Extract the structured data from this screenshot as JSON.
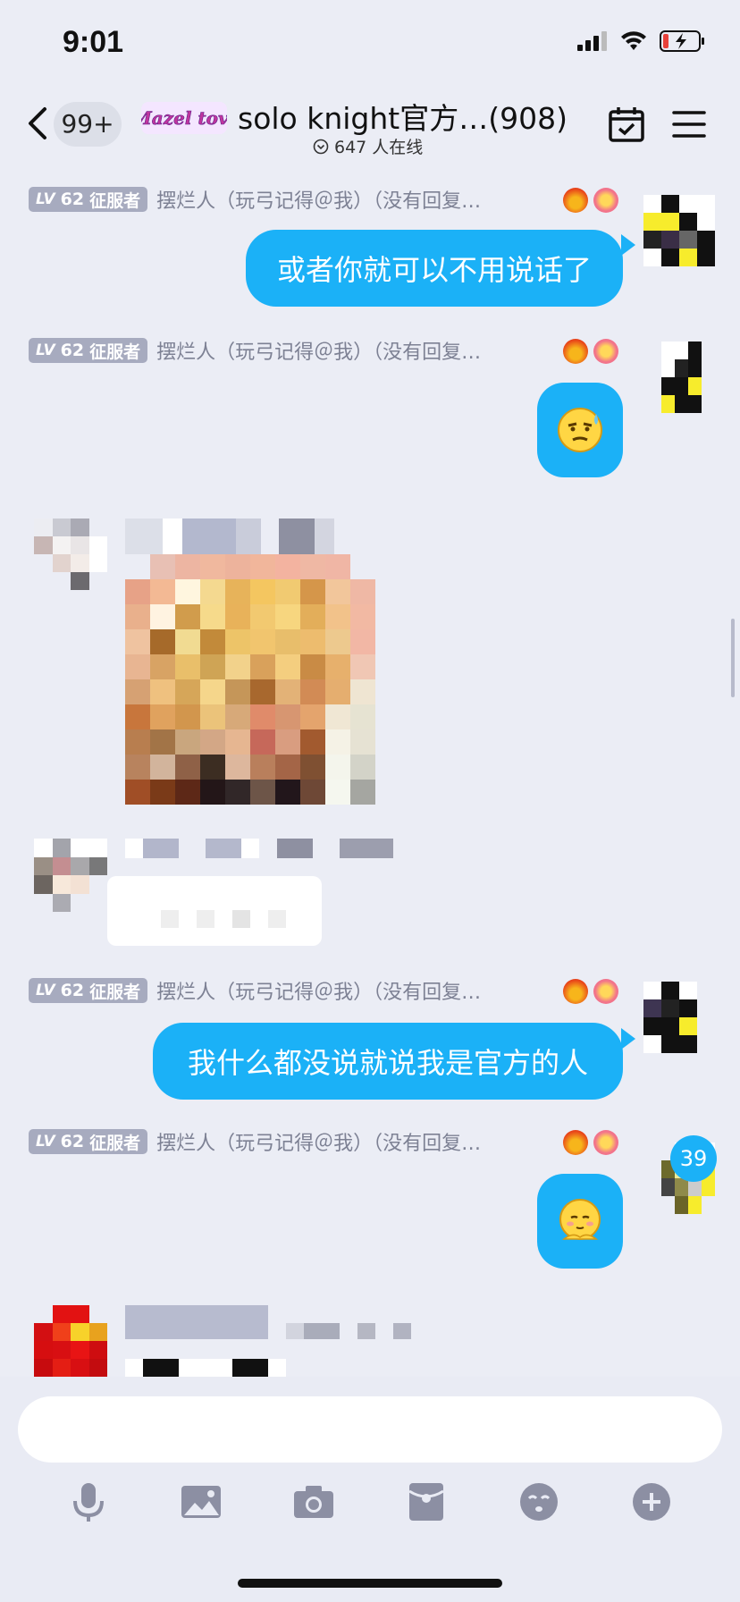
{
  "status_bar": {
    "time": "9:01",
    "battery_color": "#E8413A"
  },
  "header": {
    "back_count": "99+",
    "logo_text": "Mazel tov!",
    "title": "solo knight官方…(908)",
    "online_count": "647 人在线"
  },
  "messages": [
    {
      "level": "62",
      "level_prefix": "LV",
      "rank": "征服者",
      "sender": "摆烂人（玩弓记得＠我）（没有回复…",
      "text": "或者你就可以不用说话了"
    },
    {
      "level": "62",
      "level_prefix": "LV",
      "rank": "征服者",
      "sender": "摆烂人（玩弓记得＠我）（没有回复…",
      "sticker": "sweat-smirk-emoji"
    },
    {
      "level": "62",
      "level_prefix": "LV",
      "rank": "征服者",
      "sender": "摆烂人（玩弓记得＠我）（没有回复…",
      "text": "我什么都没说就说我是官方的人"
    },
    {
      "level": "62",
      "level_prefix": "LV",
      "rank": "征服者",
      "sender": "摆烂人（玩弓记得＠我）（没有回复…",
      "sticker": "shy-emoji"
    }
  ],
  "unread_badge": "39",
  "toolbar": [
    "microphone-icon",
    "image-icon",
    "camera-icon",
    "red-packet-icon",
    "emoji-icon",
    "plus-icon"
  ],
  "colors": {
    "accent": "#1BB1F7",
    "badge_gray": "#A7ABBF",
    "background": "#EBEDF5"
  }
}
